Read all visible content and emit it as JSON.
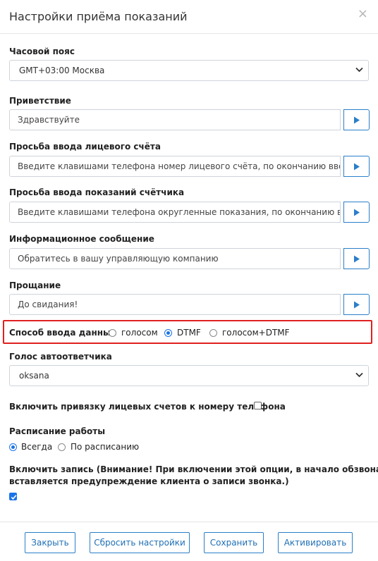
{
  "modal": {
    "title": "Настройки приёма показаний",
    "close": "×"
  },
  "timezone": {
    "label": "Часовой пояс",
    "value": "GMT+03:00 Москва"
  },
  "greeting": {
    "label": "Приветствие",
    "value": "Здравствуйте"
  },
  "account_prompt": {
    "label": "Просьба ввода лицевого счёта",
    "value": "Введите клавишами телефона номер лицевого счёта, по окончанию ввода н"
  },
  "meter_prompt": {
    "label": "Просьба ввода показаний счётчика",
    "value": "Введите клавишами телефона округленные показания, по окончанию ввода"
  },
  "info_message": {
    "label": "Информационное сообщение",
    "value": "Обратитесь в вашу управляющую компанию"
  },
  "farewell": {
    "label": "Прощание",
    "value": "До свидания!"
  },
  "input_method": {
    "label": "Способ ввода данных",
    "options": [
      "голосом",
      "DTMF",
      "голосом+DTMF"
    ],
    "selected": "DTMF"
  },
  "voice": {
    "label": "Голос автоответчика",
    "value": "oksana"
  },
  "phone_binding": {
    "label": "Включить привязку лицевых счетов к номеру телефона",
    "checked": false
  },
  "schedule": {
    "label": "Расписание работы",
    "options": [
      "Всегда",
      "По расписанию"
    ],
    "selected": "Всегда"
  },
  "recording": {
    "label_line1": "Включить запись (Внимание! При включении этой опции, в начало обзвона",
    "label_line2": "вставляется предупреждение клиента о записи звонка.)",
    "checked": true
  },
  "footer": {
    "close_label": "Закрыть",
    "reset_label": "Сбросить настройки",
    "save_label": "Сохранить",
    "activate_label": "Активировать"
  },
  "colors": {
    "accent": "#2a7fc9",
    "highlight_border": "#e02020",
    "radio_checked": "#1a73e8"
  }
}
